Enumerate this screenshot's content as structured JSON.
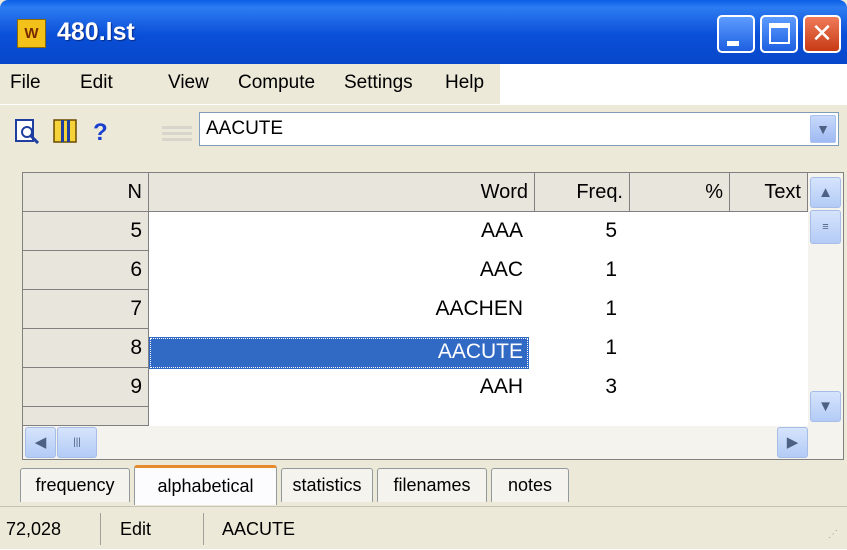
{
  "window": {
    "title": "480.lst",
    "app_icon_text": "W"
  },
  "menu": [
    "File",
    "Edit",
    "View",
    "Compute",
    "Settings",
    "Help"
  ],
  "toolbar": {
    "search_value": "AACUTE"
  },
  "grid": {
    "columns": [
      "N",
      "Word",
      "Freq.",
      "%",
      "Text"
    ],
    "rows": [
      {
        "n": "5",
        "word": "AAA",
        "freq": "5"
      },
      {
        "n": "6",
        "word": "AAC",
        "freq": "1"
      },
      {
        "n": "7",
        "word": "AACHEN",
        "freq": "1"
      },
      {
        "n": "8",
        "word": "AACUTE",
        "freq": "1",
        "selected": true
      },
      {
        "n": "9",
        "word": "AAH",
        "freq": "3"
      }
    ]
  },
  "tabs": [
    "frequency",
    "alphabetical",
    "statistics",
    "filenames",
    "notes"
  ],
  "active_tab": "alphabetical",
  "status": {
    "count": "72,028",
    "mode": "Edit",
    "current": "AACUTE"
  },
  "colors": {
    "title_bar": "#0a4fd8",
    "selection": "#316ac5",
    "tab_accent": "#e68b2c"
  }
}
